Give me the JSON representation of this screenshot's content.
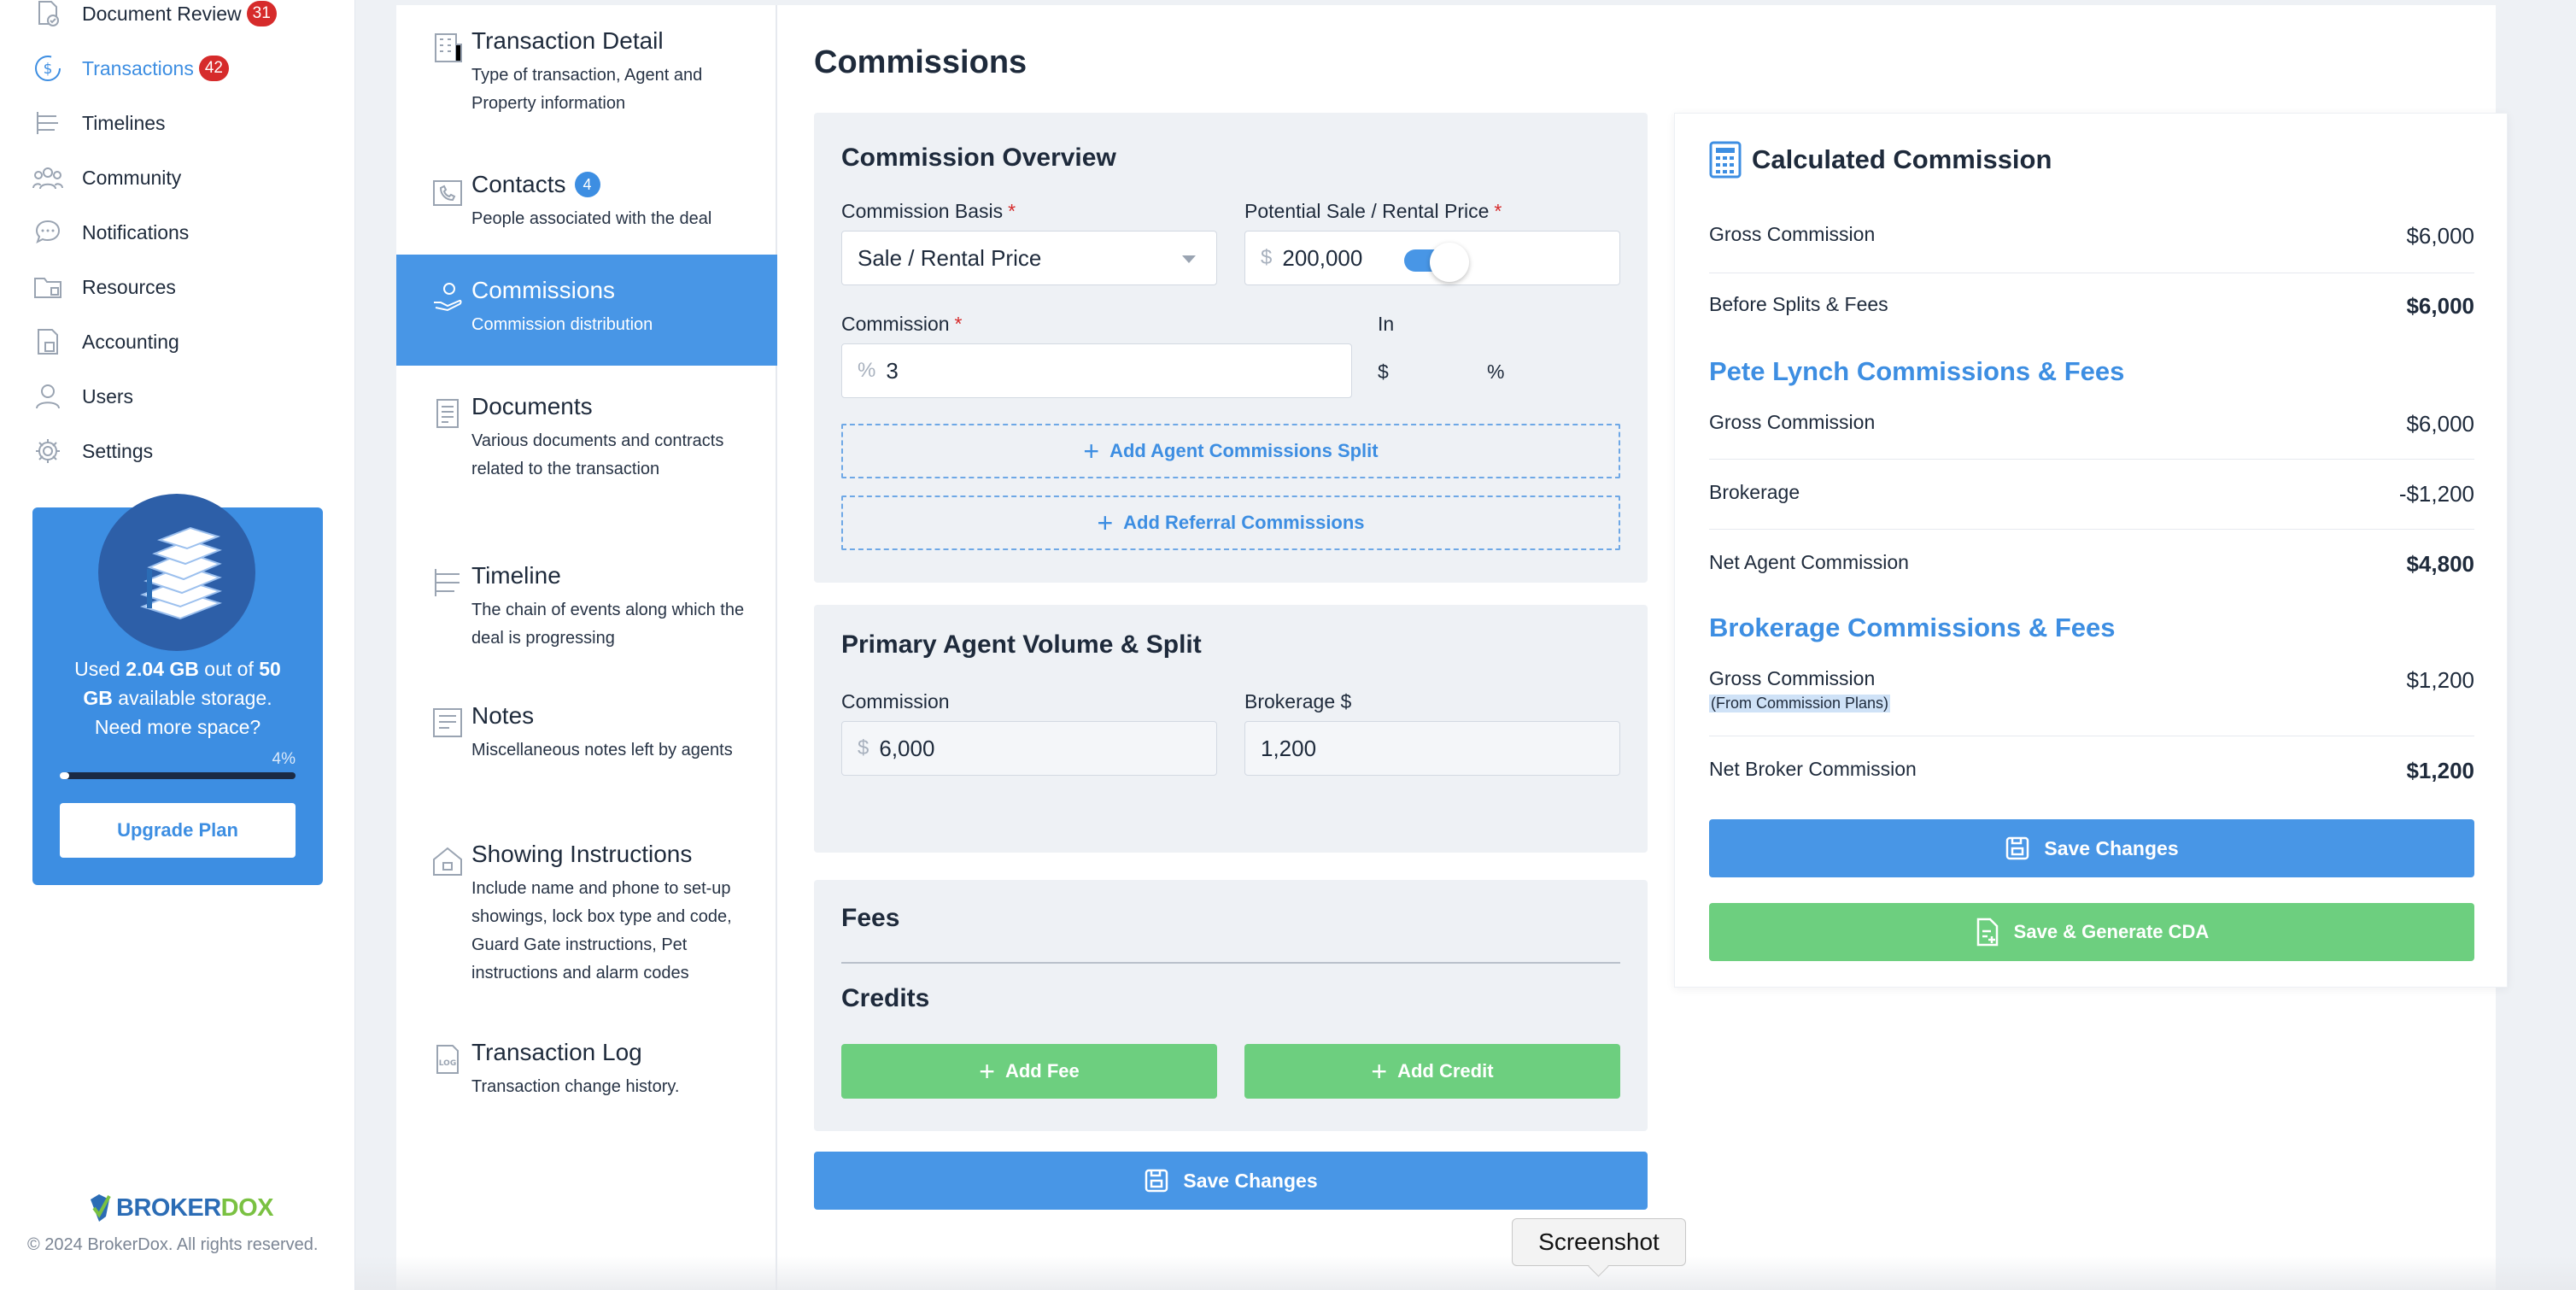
{
  "colors": {
    "accent": "#3d8ee2",
    "badge": "#d62b2b",
    "green": "#6dcf7f",
    "brand_blue": "#2b6cb5",
    "brand_green": "#7ac142"
  },
  "sidebar": {
    "items": [
      {
        "label": "Document Review",
        "badge": "31",
        "icon": "document-check-icon"
      },
      {
        "label": "Transactions",
        "badge": "42",
        "icon": "dollar-circle-icon",
        "active": true
      },
      {
        "label": "Timelines",
        "icon": "timeline-icon"
      },
      {
        "label": "Community",
        "icon": "community-icon"
      },
      {
        "label": "Notifications",
        "icon": "chat-bubble-icon"
      },
      {
        "label": "Resources",
        "icon": "folder-icon"
      },
      {
        "label": "Accounting",
        "icon": "accounting-icon"
      },
      {
        "label": "Users",
        "icon": "user-icon"
      },
      {
        "label": "Settings",
        "icon": "gear-icon"
      }
    ],
    "storage": {
      "used_prefix": "Used ",
      "used": "2.04 GB",
      "mid": " out of ",
      "total": "50 GB",
      "suffix": " available storage. Need more space?",
      "percent_label": "4%",
      "percent": 4,
      "upgrade_label": "Upgrade Plan"
    },
    "brand": {
      "part1": "BROKER",
      "part2": "DOX"
    },
    "copyright": "© 2024 BrokerDox. All rights reserved."
  },
  "steps": [
    {
      "title": "Transaction Detail",
      "desc": "Type of transaction, Agent and Property information",
      "icon": "building-icon"
    },
    {
      "title": "Contacts",
      "badge": "4",
      "desc": "People associated with the deal",
      "icon": "phone-book-icon"
    },
    {
      "title": "Commissions",
      "desc": "Commission distribution",
      "icon": "hand-coin-icon",
      "active": true
    },
    {
      "title": "Documents",
      "desc": "Various documents and contracts related to the transaction",
      "icon": "document-icon"
    },
    {
      "title": "Timeline",
      "desc": "The chain of events along which the deal is progressing",
      "icon": "timeline-icon"
    },
    {
      "title": "Notes",
      "desc": "Miscellaneous notes left by agents",
      "icon": "note-icon"
    },
    {
      "title": "Showing Instructions",
      "desc": "Include name and phone to set-up showings, lock box type and code, Guard Gate instructions, Pet instructions and alarm codes",
      "icon": "house-icon"
    },
    {
      "title": "Transaction Log",
      "desc": "Transaction change history.",
      "icon": "log-icon"
    }
  ],
  "main": {
    "title": "Commissions",
    "overview": {
      "title": "Commission Overview",
      "basis_label": "Commission Basis",
      "basis_value": "Sale / Rental Price",
      "price_label": "Potential Sale / Rental Price",
      "price_prefix": "$",
      "price_value": "200,000",
      "commission_label": "Commission",
      "commission_prefix": "%",
      "commission_value": "3",
      "in_label": "In",
      "toggle_left": "$",
      "toggle_right": "%",
      "add_split": "Add Agent Commissions Split",
      "add_referral": "Add Referral Commissions"
    },
    "primary": {
      "title": "Primary Agent Volume & Split",
      "commission_label": "Commission",
      "commission_prefix": "$",
      "commission_value": "6,000",
      "brokerage_label": "Brokerage $",
      "brokerage_value": "1,200"
    },
    "fees": {
      "fees_title": "Fees",
      "credits_title": "Credits",
      "add_fee": "Add Fee",
      "add_credit": "Add Credit"
    },
    "save_label": "Save Changes",
    "required_mark": "*"
  },
  "calc": {
    "title": "Calculated Commission",
    "gross_label": "Gross Commission",
    "gross_value": "$6,000",
    "before_label": "Before Splits & Fees",
    "before_value": "$6,000",
    "agent_section": "Pete Lynch Commissions & Fees",
    "agent_gross_label": "Gross Commission",
    "agent_gross_value": "$6,000",
    "brokerage_label": "Brokerage",
    "brokerage_value": "-$1,200",
    "net_agent_label": "Net Agent Commission",
    "net_agent_value": "$4,800",
    "broker_section": "Brokerage Commissions & Fees",
    "broker_gross_label": "Gross Commission",
    "broker_gross_value": "$1,200",
    "broker_gross_note": "(From Commission Plans)",
    "net_broker_label": "Net Broker Commission",
    "net_broker_value": "$1,200",
    "save_label": "Save Changes",
    "save_cda_label": "Save & Generate CDA"
  },
  "tooltip": "Screenshot"
}
